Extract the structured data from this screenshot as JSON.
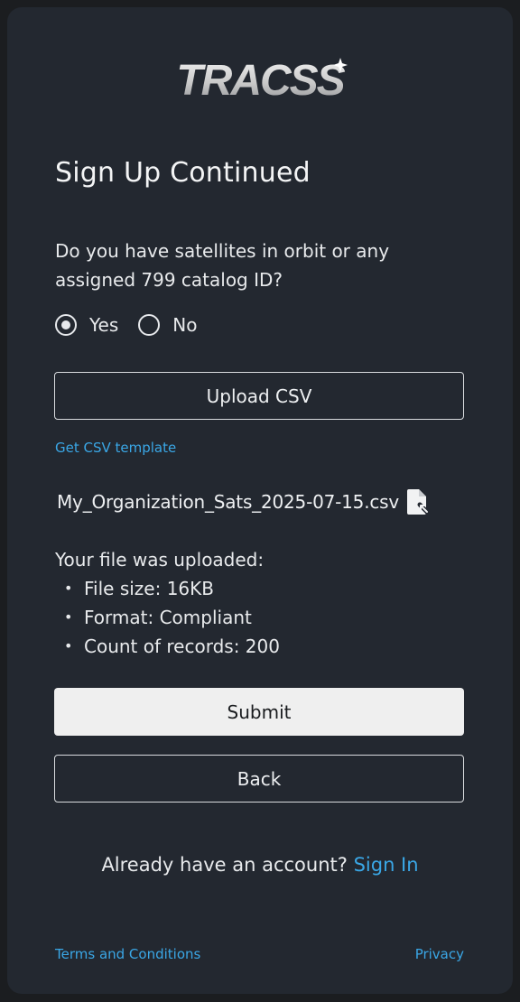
{
  "logo": {
    "text": "TRACSS"
  },
  "title": "Sign Up Continued",
  "question": "Do you have satellites in orbit or any assigned 799 catalog ID?",
  "radio": {
    "options": [
      {
        "label": "Yes",
        "checked": true
      },
      {
        "label": "No",
        "checked": false
      }
    ]
  },
  "upload_button": "Upload CSV",
  "template_link": "Get CSV template",
  "file": {
    "name": "My_Organization_Sats_2025-07-15.csv",
    "icon": "file-icon"
  },
  "upload_status": {
    "heading": "Your file was uploaded:",
    "details": [
      "File size: 16KB",
      "Format: Compliant",
      "Count of records: 200"
    ]
  },
  "submit_button": "Submit",
  "back_button": "Back",
  "signin": {
    "prompt": "Already have an account?",
    "link": "Sign In"
  },
  "footer": {
    "terms": "Terms and Conditions",
    "privacy": "Privacy"
  },
  "colors": {
    "page_background": "#1b1d20",
    "card_background": "#232830",
    "link": "#3aa7e6",
    "primary_button": "#efefef"
  }
}
